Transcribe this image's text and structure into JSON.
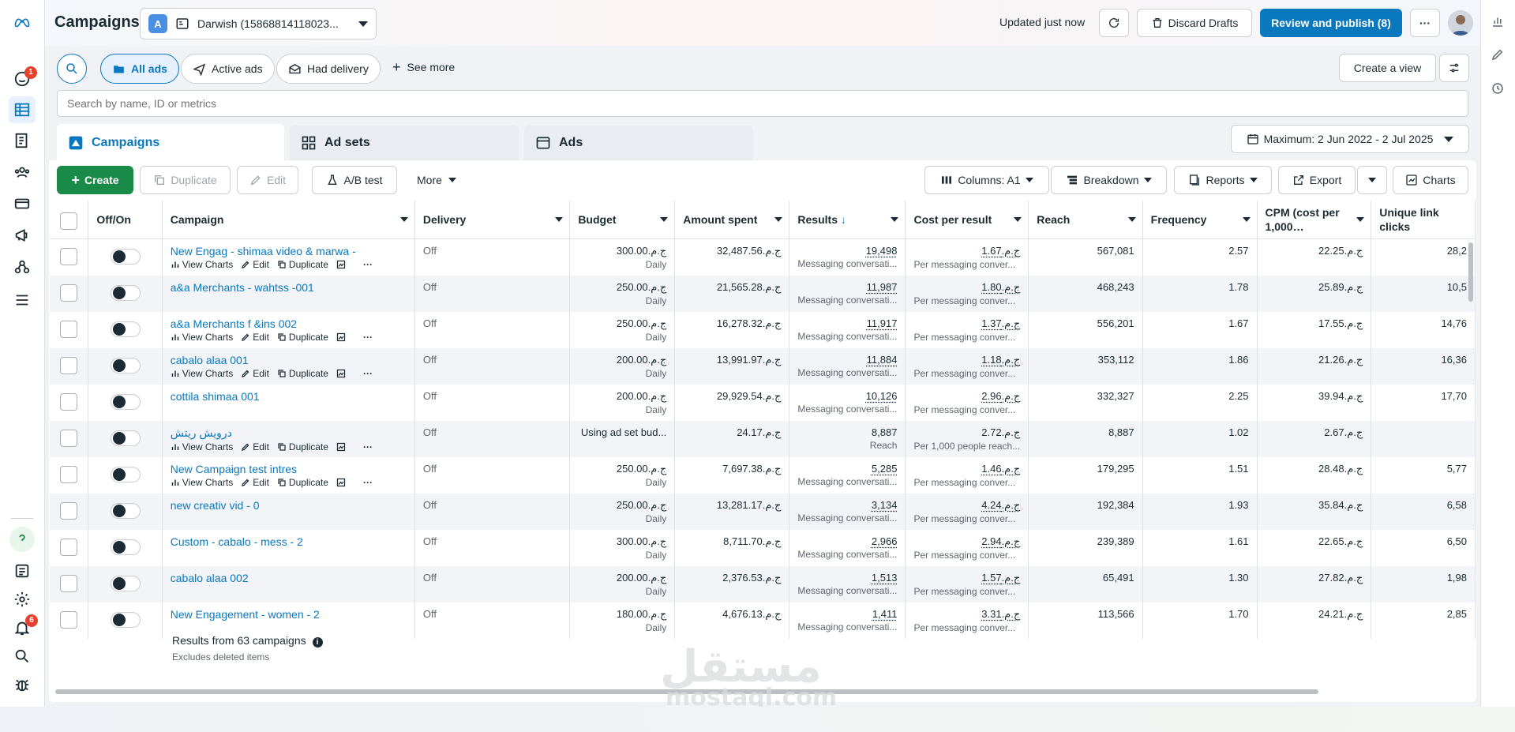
{
  "header": {
    "title": "Campaigns",
    "account_badge": "A",
    "account_name": "Darwish (15868814118023...",
    "updated_text": "Updated just now",
    "discard_label": "Discard Drafts",
    "publish_label": "Review and publish (8)",
    "more_label": "···"
  },
  "rail": {
    "notifications_badge": "1",
    "alerts_badge": "6"
  },
  "filters": {
    "all_ads": "All ads",
    "active_ads": "Active ads",
    "had_delivery": "Had delivery",
    "see_more": "See more",
    "create_view": "Create a view"
  },
  "search": {
    "placeholder": "Search by name, ID or metrics"
  },
  "tabs": {
    "campaigns": "Campaigns",
    "ad_sets": "Ad sets",
    "ads": "Ads"
  },
  "date_range": "Maximum: 2 Jun 2022 - 2 Jul 2025",
  "toolbar": {
    "create": "Create",
    "duplicate": "Duplicate",
    "edit": "Edit",
    "ab_test": "A/B test",
    "more": "More",
    "columns": "Columns: A1",
    "breakdown": "Breakdown",
    "reports": "Reports",
    "export": "Export",
    "charts": "Charts"
  },
  "table": {
    "headers": {
      "offon": "Off/On",
      "campaign": "Campaign",
      "delivery": "Delivery",
      "budget": "Budget",
      "amount": "Amount spent",
      "results": "Results",
      "cpr": "Cost per result",
      "reach": "Reach",
      "frequency": "Frequency",
      "cpm": "CPM (cost per 1,000…",
      "ulc": "Unique link clicks"
    },
    "row_actions": {
      "charts": "View Charts",
      "edit": "Edit",
      "duplicate": "Duplicate"
    },
    "rows": [
      {
        "name": "New Engag - shimaa video & marwa -",
        "delivery": "Off",
        "budget": "ج.م.300.00",
        "budget_sub": "Daily",
        "amount": "ج.م.32,487.56",
        "results": "19,498",
        "results_sub": "Messaging conversati...",
        "cpr": "ج.م.1.67",
        "cpr_sub": "Per messaging conver...",
        "reach": "567,081",
        "frequency": "2.57",
        "cpm": "ج.م.22.25",
        "ulc": "28,2",
        "actions": true
      },
      {
        "name": "a&a Merchants - wahtss -001",
        "delivery": "Off",
        "budget": "ج.م.250.00",
        "budget_sub": "Daily",
        "amount": "ج.م.21,565.28",
        "results": "11,987",
        "results_sub": "Messaging conversati...",
        "cpr": "ج.م.1.80",
        "cpr_sub": "Per messaging conver...",
        "reach": "468,243",
        "frequency": "1.78",
        "cpm": "ج.م.25.89",
        "ulc": "10,5",
        "actions": false
      },
      {
        "name": "a&a Merchants f &ins 002",
        "delivery": "Off",
        "budget": "ج.م.250.00",
        "budget_sub": "Daily",
        "amount": "ج.م.16,278.32",
        "results": "11,917",
        "results_sub": "Messaging conversati...",
        "cpr": "ج.م.1.37",
        "cpr_sub": "Per messaging conver...",
        "reach": "556,201",
        "frequency": "1.67",
        "cpm": "ج.م.17.55",
        "ulc": "14,76",
        "actions": true
      },
      {
        "name": "cabalo alaa 001",
        "delivery": "Off",
        "budget": "ج.م.200.00",
        "budget_sub": "Daily",
        "amount": "ج.م.13,991.97",
        "results": "11,884",
        "results_sub": "Messaging conversati...",
        "cpr": "ج.م.1.18",
        "cpr_sub": "Per messaging conver...",
        "reach": "353,112",
        "frequency": "1.86",
        "cpm": "ج.م.21.26",
        "ulc": "16,36",
        "actions": true
      },
      {
        "name": "cottila shimaa 001",
        "delivery": "Off",
        "budget": "ج.م.200.00",
        "budget_sub": "Daily",
        "amount": "ج.م.29,929.54",
        "results": "10,126",
        "results_sub": "Messaging conversati...",
        "cpr": "ج.م.2.96",
        "cpr_sub": "Per messaging conver...",
        "reach": "332,327",
        "frequency": "2.25",
        "cpm": "ج.م.39.94",
        "ulc": "17,70",
        "actions": false
      },
      {
        "name": "درويش ريتش",
        "delivery": "Off",
        "budget": "Using ad set bud...",
        "budget_sub": "",
        "amount": "ج.م.24.17",
        "results": "8,887",
        "results_sub": "Reach",
        "cpr": "ج.م.2.72",
        "cpr_sub": "Per 1,000 people reach...",
        "reach": "8,887",
        "frequency": "1.02",
        "cpm": "ج.م.2.67",
        "ulc": "",
        "actions": true
      },
      {
        "name": "New Campaign test intres",
        "delivery": "Off",
        "budget": "ج.م.250.00",
        "budget_sub": "Daily",
        "amount": "ج.م.7,697.38",
        "results": "5,285",
        "results_sub": "Messaging conversati...",
        "cpr": "ج.م.1.46",
        "cpr_sub": "Per messaging conver...",
        "reach": "179,295",
        "frequency": "1.51",
        "cpm": "ج.م.28.48",
        "ulc": "5,77",
        "actions": true
      },
      {
        "name": "new creativ vid - 0",
        "delivery": "Off",
        "budget": "ج.م.250.00",
        "budget_sub": "Daily",
        "amount": "ج.م.13,281.17",
        "results": "3,134",
        "results_sub": "Messaging conversati...",
        "cpr": "ج.م.4.24",
        "cpr_sub": "Per messaging conver...",
        "reach": "192,384",
        "frequency": "1.93",
        "cpm": "ج.م.35.84",
        "ulc": "6,58",
        "actions": false
      },
      {
        "name": "Custom - cabalo - mess - 2",
        "delivery": "Off",
        "budget": "ج.م.300.00",
        "budget_sub": "Daily",
        "amount": "ج.م.8,711.70",
        "results": "2,966",
        "results_sub": "Messaging conversati...",
        "cpr": "ج.م.2.94",
        "cpr_sub": "Per messaging conver...",
        "reach": "239,389",
        "frequency": "1.61",
        "cpm": "ج.م.22.65",
        "ulc": "6,50",
        "actions": false
      },
      {
        "name": "cabalo alaa 002",
        "delivery": "Off",
        "budget": "ج.م.200.00",
        "budget_sub": "Daily",
        "amount": "ج.م.2,376.53",
        "results": "1,513",
        "results_sub": "Messaging conversati...",
        "cpr": "ج.م.1.57",
        "cpr_sub": "Per messaging conver...",
        "reach": "65,491",
        "frequency": "1.30",
        "cpm": "ج.م.27.82",
        "ulc": "1,98",
        "actions": false
      },
      {
        "name": "New Engagement - women - 2",
        "delivery": "Off",
        "budget": "ج.م.180.00",
        "budget_sub": "Daily",
        "amount": "ج.م.4,676.13",
        "results": "1,411",
        "results_sub": "Messaging conversati...",
        "cpr": "ج.م.3.31",
        "cpr_sub": "Per messaging conver...",
        "reach": "113,566",
        "frequency": "1.70",
        "cpm": "ج.م.24.21",
        "ulc": "2,85",
        "actions": false
      }
    ]
  },
  "summary": {
    "text": "Results from 63 campaigns",
    "sub": "Excludes deleted items"
  },
  "watermark": {
    "arabic": "مستقل",
    "latin": "mostaql.com"
  }
}
